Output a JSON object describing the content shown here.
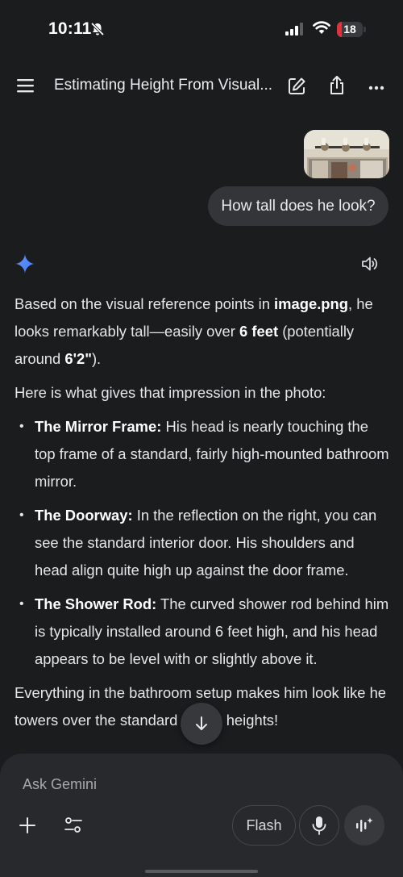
{
  "status_bar": {
    "time": "10:11",
    "battery_level": "18",
    "battery_fraction": 0.18,
    "battery_color": "#e0323a"
  },
  "header": {
    "title": "Estimating Height From Visual..."
  },
  "user_message": {
    "text": "How tall does he look?"
  },
  "response": {
    "intro": {
      "t1": "Based on the visual reference points in ",
      "b1": "image.png",
      "t2": ", he looks remarkably tall—easily over ",
      "b2": "6 feet",
      "t3": " (potentially around ",
      "b3": "6'2\"",
      "t4": ")."
    },
    "lead_in": "Here is what gives that impression in the photo:",
    "bullets": [
      {
        "title": "The Mirror Frame:",
        "text": " His head is nearly touching the top frame of a standard, fairly high-mounted bathroom mirror."
      },
      {
        "title": "The Doorway:",
        "text": " In the reflection on the right, you can see the standard interior door. His shoulders and head align quite high up against the door frame."
      },
      {
        "title": "The Shower Rod:",
        "text": " The curved shower rod behind him is typically installed around 6 feet high, and his head appears to be level with or slightly above it."
      }
    ],
    "conclusion": "Everything in the bathroom setup makes him look like he towers over the standard fixture heights!"
  },
  "input": {
    "placeholder": "Ask Gemini",
    "value": ""
  },
  "toolbar": {
    "model_label": "Flash"
  },
  "colors": {
    "background": "#1b1c1e",
    "bubble": "#333538",
    "panel": "#28292c",
    "gemini_blue": "#4a86f7"
  }
}
